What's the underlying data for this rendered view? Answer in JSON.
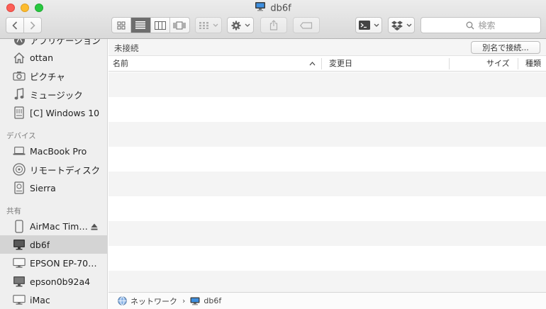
{
  "window": {
    "title": "db6f"
  },
  "toolbar": {
    "search_placeholder": "検索"
  },
  "sidebar": {
    "sections": [
      {
        "heading": "デバイス"
      },
      {
        "heading": "共有"
      }
    ],
    "items": [
      {
        "label": "アプリケーション",
        "icon": "apps-icon"
      },
      {
        "label": "ottan",
        "icon": "home-icon"
      },
      {
        "label": "ピクチャ",
        "icon": "camera-icon"
      },
      {
        "label": "ミュージック",
        "icon": "music-icon"
      },
      {
        "label": "[C] Windows 10",
        "icon": "drive-icon"
      },
      {
        "label": "MacBook Pro",
        "icon": "laptop-icon"
      },
      {
        "label": "リモートディスク",
        "icon": "disc-icon"
      },
      {
        "label": "Sierra",
        "icon": "drive-icon"
      },
      {
        "label": "AirMac Tim…",
        "icon": "airport-icon"
      },
      {
        "label": "db6f",
        "icon": "pc-icon"
      },
      {
        "label": "EPSON EP-70…",
        "icon": "display-icon"
      },
      {
        "label": "epson0b92a4",
        "icon": "display-icon"
      },
      {
        "label": "iMac",
        "icon": "display-icon"
      }
    ]
  },
  "content": {
    "status": "未接続",
    "connect_button": "別名で接続...",
    "columns": {
      "name": "名前",
      "modified": "変更日",
      "size": "サイズ",
      "kind": "種類"
    }
  },
  "pathbar": {
    "items": [
      "ネットワーク",
      "db6f"
    ]
  },
  "colors": {
    "selected_row": "#d4d4d4",
    "sidebar_bg": "#efefef",
    "stripe": "#f4f4f4"
  }
}
